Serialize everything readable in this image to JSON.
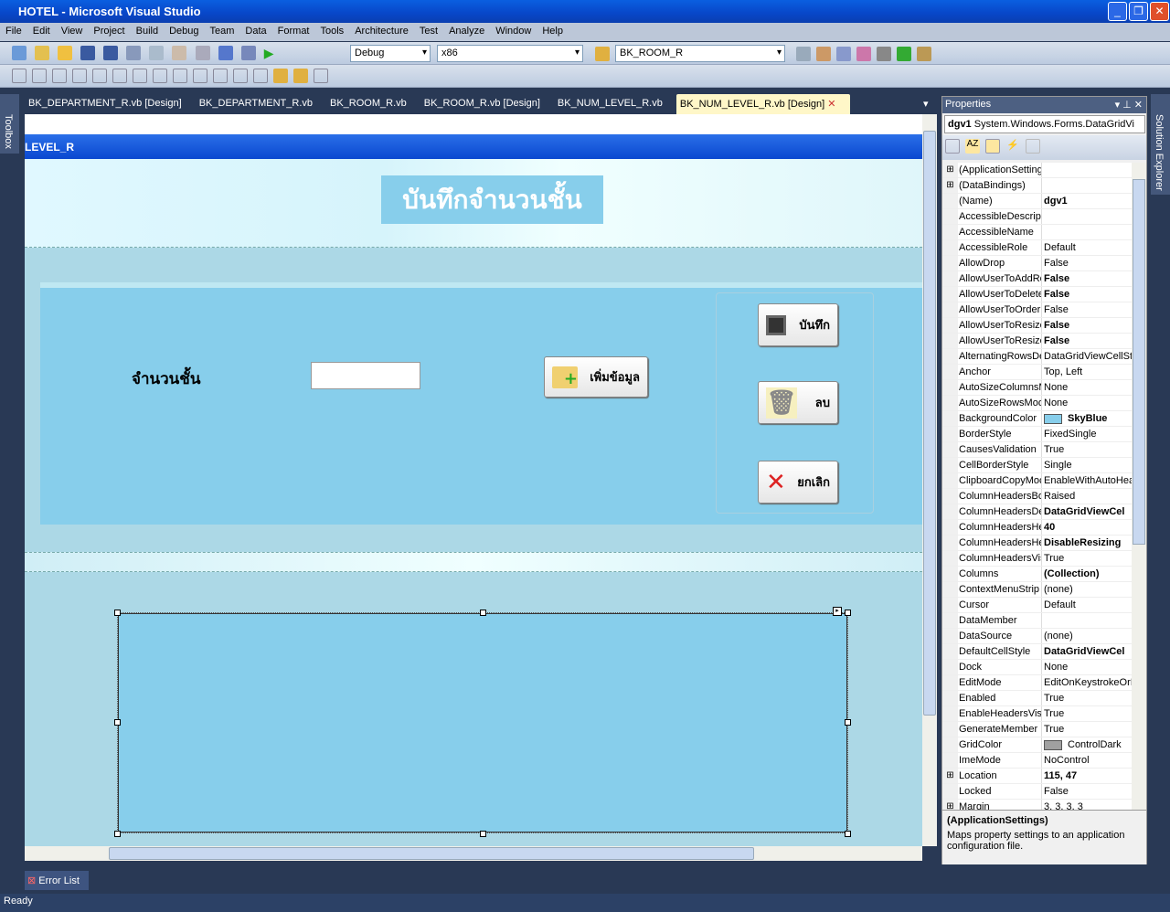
{
  "window": {
    "title": "HOTEL - Microsoft Visual Studio"
  },
  "menu": [
    "File",
    "Edit",
    "View",
    "Project",
    "Build",
    "Debug",
    "Team",
    "Data",
    "Format",
    "Tools",
    "Architecture",
    "Test",
    "Analyze",
    "Window",
    "Help"
  ],
  "toolbar": {
    "config": "Debug",
    "platform": "x86",
    "find": "BK_ROOM_R"
  },
  "side": {
    "toolbox": "Toolbox",
    "solution_explorer": "Solution Explorer"
  },
  "tabs": [
    {
      "label": "BK_DEPARTMENT_R.vb [Design]"
    },
    {
      "label": "BK_DEPARTMENT_R.vb"
    },
    {
      "label": "BK_ROOM_R.vb"
    },
    {
      "label": "BK_ROOM_R.vb [Design]"
    },
    {
      "label": "BK_NUM_LEVEL_R.vb"
    },
    {
      "label": "BK_NUM_LEVEL_R.vb [Design]"
    }
  ],
  "form": {
    "title": "LEVEL_R",
    "heading": "บันทึกจำนวนชั้น",
    "field_label": "จำนวนชั้น",
    "field_value": "",
    "add_button": "เพิ่มข้อมูล",
    "save_button": "บันทึก",
    "delete_button": "ลบ",
    "cancel_button": "ยกเลิก"
  },
  "properties": {
    "title": "Properties",
    "object_name": "dgv1",
    "object_type": "System.Windows.Forms.DataGridVi",
    "rows": [
      {
        "name": "(ApplicationSetting",
        "value": "",
        "expand": true
      },
      {
        "name": "(DataBindings)",
        "value": "",
        "expand": true
      },
      {
        "name": "(Name)",
        "value": "dgv1",
        "bold": true
      },
      {
        "name": "AccessibleDescript",
        "value": ""
      },
      {
        "name": "AccessibleName",
        "value": ""
      },
      {
        "name": "AccessibleRole",
        "value": "Default"
      },
      {
        "name": "AllowDrop",
        "value": "False"
      },
      {
        "name": "AllowUserToAddRc",
        "value": "False",
        "bold": true
      },
      {
        "name": "AllowUserToDelete",
        "value": "False",
        "bold": true
      },
      {
        "name": "AllowUserToOrder",
        "value": "False"
      },
      {
        "name": "AllowUserToResize",
        "value": "False",
        "bold": true
      },
      {
        "name": "AllowUserToResize",
        "value": "False",
        "bold": true
      },
      {
        "name": "AlternatingRowsDe",
        "value": "DataGridViewCellSty"
      },
      {
        "name": "Anchor",
        "value": "Top, Left"
      },
      {
        "name": "AutoSizeColumnsM",
        "value": "None"
      },
      {
        "name": "AutoSizeRowsMod",
        "value": "None"
      },
      {
        "name": "BackgroundColor",
        "value": "SkyBlue",
        "bold": true,
        "swatch": "#87ceeb"
      },
      {
        "name": "BorderStyle",
        "value": "FixedSingle"
      },
      {
        "name": "CausesValidation",
        "value": "True"
      },
      {
        "name": "CellBorderStyle",
        "value": "Single"
      },
      {
        "name": "ClipboardCopyMoc",
        "value": "EnableWithAutoHea"
      },
      {
        "name": "ColumnHeadersBoi",
        "value": "Raised"
      },
      {
        "name": "ColumnHeadersDe",
        "value": "DataGridViewCel",
        "bold": true
      },
      {
        "name": "ColumnHeadersHe",
        "value": "40",
        "bold": true
      },
      {
        "name": "ColumnHeadersHe",
        "value": "DisableResizing",
        "bold": true
      },
      {
        "name": "ColumnHeadersVis",
        "value": "True"
      },
      {
        "name": "Columns",
        "value": "(Collection)",
        "bold": true
      },
      {
        "name": "ContextMenuStrip",
        "value": "(none)"
      },
      {
        "name": "Cursor",
        "value": "Default"
      },
      {
        "name": "DataMember",
        "value": ""
      },
      {
        "name": "DataSource",
        "value": "(none)"
      },
      {
        "name": "DefaultCellStyle",
        "value": "DataGridViewCel",
        "bold": true
      },
      {
        "name": "Dock",
        "value": "None"
      },
      {
        "name": "EditMode",
        "value": "EditOnKeystrokeOrI"
      },
      {
        "name": "Enabled",
        "value": "True"
      },
      {
        "name": "EnableHeadersVisu",
        "value": "True"
      },
      {
        "name": "GenerateMember",
        "value": "True"
      },
      {
        "name": "GridColor",
        "value": "ControlDark",
        "swatch": "#a0a0a0"
      },
      {
        "name": "ImeMode",
        "value": "NoControl"
      },
      {
        "name": "Location",
        "value": "115, 47",
        "bold": true,
        "expand": true
      },
      {
        "name": "Locked",
        "value": "False"
      },
      {
        "name": "Margin",
        "value": "3, 3, 3, 3",
        "expand": true
      }
    ],
    "desc_title": "(ApplicationSettings)",
    "desc_text": "Maps property settings to an application configuration file."
  },
  "error_list": "Error List",
  "status": "Ready"
}
